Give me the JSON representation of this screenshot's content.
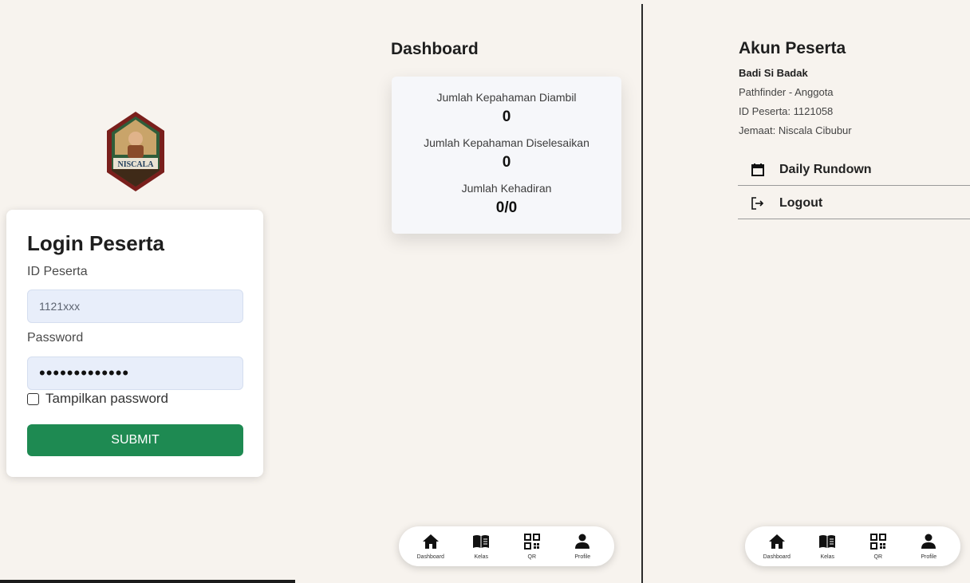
{
  "login": {
    "title": "Login Peserta",
    "id_label": "ID Peserta",
    "id_value": "1121xxx",
    "password_label": "Password",
    "password_value": "•••••••••••••",
    "show_password_label": "Tampilkan password",
    "submit_label": "SUBMIT",
    "logo_text": "NISCALA"
  },
  "dashboard": {
    "title": "Dashboard",
    "stats": [
      {
        "label": "Jumlah Kepahaman Diambil",
        "value": "0"
      },
      {
        "label": "Jumlah Kepahaman Diselesaikan",
        "value": "0"
      },
      {
        "label": "Jumlah Kehadiran",
        "value": "0/0"
      }
    ]
  },
  "profile": {
    "title": "Akun Peserta",
    "name": "Badi Si Badak",
    "role": "Pathfinder - Anggota",
    "id_line": "ID Peserta: 1121058",
    "church_line": "Jemaat: Niscala Cibubur",
    "menu": [
      {
        "label": "Daily Rundown",
        "icon": "calendar-icon"
      },
      {
        "label": "Logout",
        "icon": "logout-icon"
      }
    ]
  },
  "nav": {
    "items": [
      {
        "label": "Dashboard",
        "icon": "home-icon"
      },
      {
        "label": "Kelas",
        "icon": "book-icon"
      },
      {
        "label": "QR",
        "icon": "qr-icon"
      },
      {
        "label": "Profile",
        "icon": "person-icon"
      }
    ]
  },
  "colors": {
    "background": "#f7f3ee",
    "submit": "#1e8a52",
    "input_bg": "#e8eefa"
  }
}
